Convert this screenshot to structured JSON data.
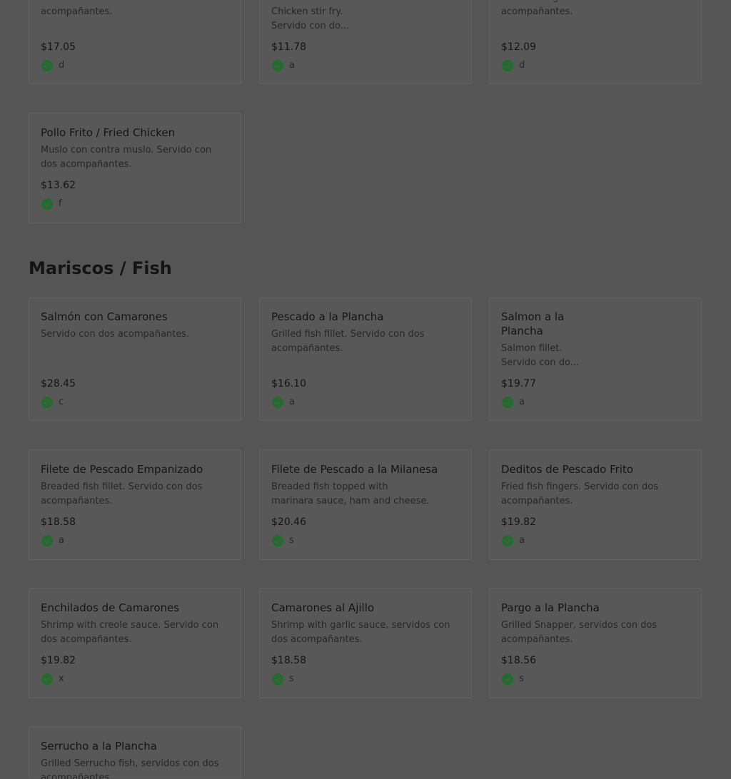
{
  "top_row": [
    {
      "desc": "Chicken breast fillet. Servido con dos acompañantes.",
      "price": "$17.05",
      "tag": "d"
    },
    {
      "desc": "Chicken stir fry. Servido con do...",
      "price": "$11.78",
      "tag": "a"
    },
    {
      "desc": "Chicken fingers. Servidos con dos acompañantes.",
      "price": "$12.09",
      "tag": "d"
    }
  ],
  "chicken_extra": {
    "title": "Pollo Frito / Fried Chicken",
    "desc": "Muslo con contra muslo. Servido con dos acompañantes.",
    "price": "$13.62",
    "tag": "f"
  },
  "section": {
    "title": "Mariscos / Fish"
  },
  "fish_items": [
    {
      "title": "Salmón con Camarones",
      "desc": "Servido con dos acompañantes.",
      "price": "$28.45",
      "tag": "c"
    },
    {
      "title": "Pescado a la Plancha",
      "desc": "Grilled fish fillet. Servido con dos acompañantes.",
      "price": "$16.10",
      "tag": "a"
    },
    {
      "title": "Salmon a la Plancha",
      "desc": "Salmon fillet. Servido con do...",
      "price": "$19.77",
      "tag": "a"
    },
    {
      "title": "Filete de Pescado Empanizado",
      "desc": "Breaded fish fillet. Servido con dos acompañantes.",
      "price": "$18.58",
      "tag": "a"
    },
    {
      "title": "Filete de Pescado a la Milanesa",
      "desc": "Breaded fish topped with marinara sauce, ham and cheese.",
      "price": "$20.46",
      "tag": "s"
    },
    {
      "title": "Deditos de Pescado Frito",
      "desc": "Fried fish fingers. Servido con dos acompañantes.",
      "price": "$19.82",
      "tag": "a"
    },
    {
      "title": "Enchilados de Camarones",
      "desc": "Shrimp with creole sauce. Servido con dos acompañantes.",
      "price": "$19.82",
      "tag": "x"
    },
    {
      "title": "Camarones al Ajillo",
      "desc": "Shrimp with garlic sauce, servidos con dos acompañantes.",
      "price": "$18.58",
      "tag": "s"
    },
    {
      "title": "Pargo a la Plancha",
      "desc": "Grilled Snapper, servidos con dos acompañantes.",
      "price": "$18.56",
      "tag": "s"
    },
    {
      "title": "Serrucho a la Plancha",
      "desc": "Grilled Serrucho fish, servidos con dos acompañantes."
    }
  ],
  "colors": {
    "check_green": "#1f6e2a",
    "overlay_dim": "#555555"
  },
  "icons": {
    "tag_icon": "check-circle-icon"
  }
}
